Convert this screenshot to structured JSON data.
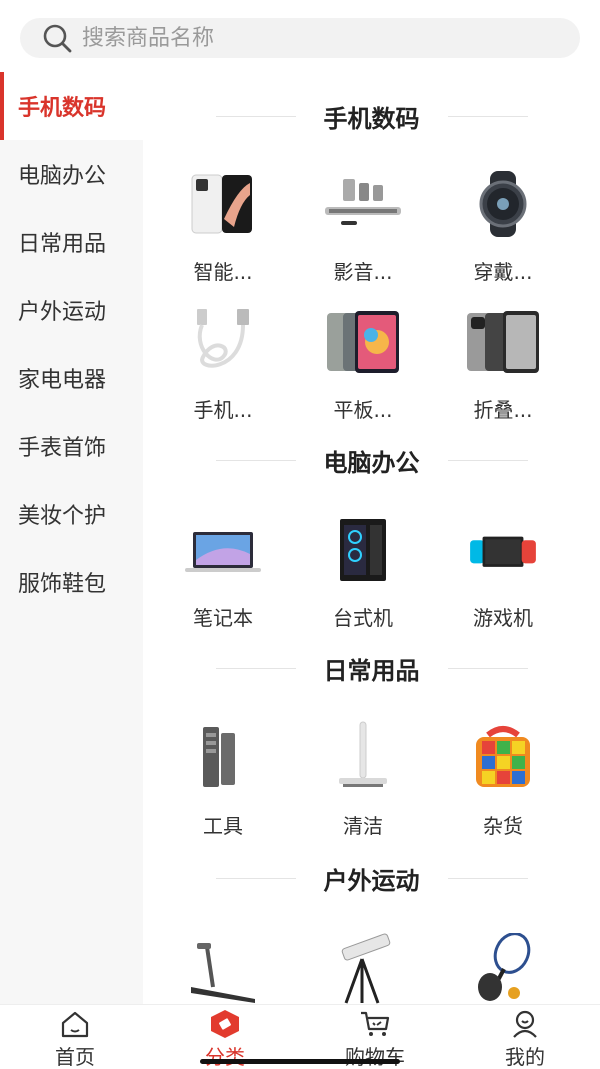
{
  "search": {
    "placeholder": "搜索商品名称"
  },
  "sidebar": {
    "items": [
      {
        "label": "手机数码",
        "active": true
      },
      {
        "label": "电脑办公"
      },
      {
        "label": "日常用品"
      },
      {
        "label": "户外运动"
      },
      {
        "label": "家电电器"
      },
      {
        "label": "手表首饰"
      },
      {
        "label": "美妆个护"
      },
      {
        "label": "服饰鞋包"
      }
    ]
  },
  "sections": [
    {
      "title": "手机数码",
      "items": [
        {
          "label": "智能...",
          "icon": "smartphone-icon"
        },
        {
          "label": "影音...",
          "icon": "speaker-icon"
        },
        {
          "label": "穿戴...",
          "icon": "smartwatch-icon"
        },
        {
          "label": "手机...",
          "icon": "usb-cable-icon"
        },
        {
          "label": "平板...",
          "icon": "tablet-icon"
        },
        {
          "label": "折叠...",
          "icon": "foldable-phone-icon"
        }
      ]
    },
    {
      "title": "电脑办公",
      "items": [
        {
          "label": "笔记本",
          "icon": "laptop-icon"
        },
        {
          "label": "台式机",
          "icon": "desktop-pc-icon"
        },
        {
          "label": "游戏机",
          "icon": "game-console-icon"
        }
      ]
    },
    {
      "title": "日常用品",
      "items": [
        {
          "label": "工具",
          "icon": "screwdriver-set-icon"
        },
        {
          "label": "清洁",
          "icon": "mop-icon"
        },
        {
          "label": "杂货",
          "icon": "cube-speaker-icon"
        }
      ]
    },
    {
      "title": "户外运动",
      "items": [
        {
          "label": "",
          "icon": "treadmill-icon"
        },
        {
          "label": "",
          "icon": "telescope-icon"
        },
        {
          "label": "",
          "icon": "tennis-racket-icon"
        }
      ]
    }
  ],
  "tabbar": {
    "tabs": [
      {
        "label": "首页",
        "icon": "home-icon"
      },
      {
        "label": "分类",
        "icon": "category-icon",
        "active": true
      },
      {
        "label": "购物车",
        "icon": "cart-icon"
      },
      {
        "label": "我的",
        "icon": "profile-icon"
      }
    ]
  },
  "colors": {
    "accent": "#d9342b",
    "sidebar_bg": "#f7f7f7",
    "search_bg": "#f2f2f2"
  }
}
